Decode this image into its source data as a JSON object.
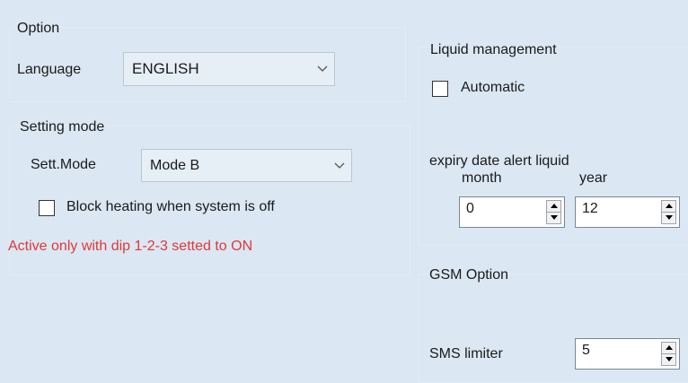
{
  "option": {
    "title": "Option",
    "language_label": "Language",
    "language_value": "ENGLISH"
  },
  "setting_mode": {
    "title": "Setting mode",
    "mode_label": "Sett.Mode",
    "mode_value": "Mode B",
    "block_heating_label": "Block heating when system is off",
    "block_heating_checked": false,
    "warning": "Active only with dip 1-2-3 setted to ON",
    "warning_color": "#e0383a"
  },
  "liquid": {
    "title": "Liquid management",
    "automatic_label": "Automatic",
    "automatic_checked": false,
    "expiry_label": "expiry date alert liquid",
    "month_label": "month",
    "month_value": "0",
    "year_label": "year",
    "year_value": "12"
  },
  "gsm": {
    "title": "GSM Option",
    "sms_label": "SMS limiter",
    "sms_value": "5"
  },
  "icons": {
    "dropdown": "chevron-down-icon",
    "spin_up": "spin-up-icon",
    "spin_down": "spin-down-icon"
  }
}
